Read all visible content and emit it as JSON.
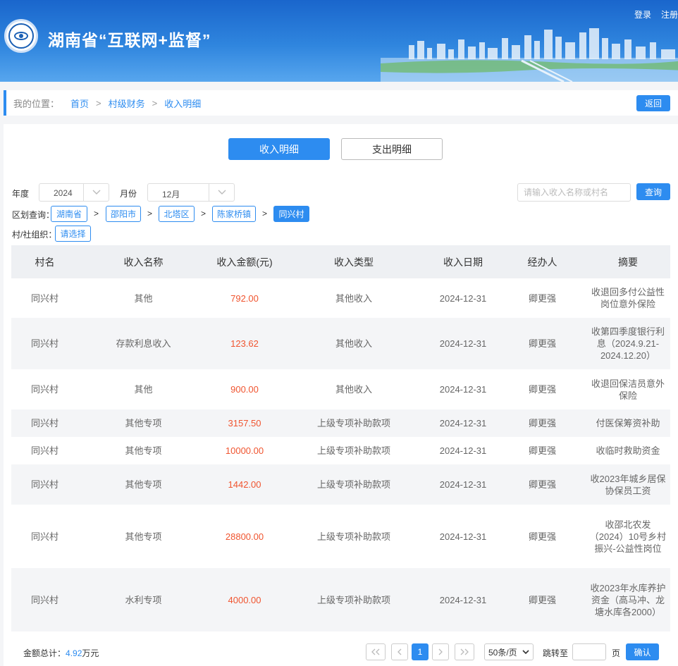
{
  "header": {
    "title": "湖南省“互联网+监督”",
    "login": "登录",
    "register": "注册"
  },
  "breadcrumb": {
    "label": "我的位置：",
    "items": [
      "首页",
      "村级财务",
      "收入明细"
    ],
    "separator": ">",
    "back": "返回"
  },
  "tabs": {
    "income": "收入明细",
    "expense": "支出明细"
  },
  "filters": {
    "year_label": "年度",
    "year_value": "2024",
    "month_label": "月份",
    "month_value": "12月",
    "search_placeholder": "请输入收入名称或村名",
    "query_button": "查询",
    "region_label": "区划查询：",
    "regions": [
      "湖南省",
      "邵阳市",
      "北塔区",
      "陈家桥镇",
      "同兴村"
    ],
    "region_separator": ">",
    "org_label": "村/社组织：",
    "org_button": "请选择"
  },
  "table": {
    "columns": [
      "村名",
      "收入名称",
      "收入金额(元)",
      "收入类型",
      "收入日期",
      "经办人",
      "摘要"
    ],
    "rows": [
      [
        "同兴村",
        "其他",
        "792.00",
        "其他收入",
        "2024-12-31",
        "卿更强",
        "收退回多付公益性岗位意外保险"
      ],
      [
        "同兴村",
        "存款利息收入",
        "123.62",
        "其他收入",
        "2024-12-31",
        "卿更强",
        "收第四季度银行利息（2024.9.21-2024.12.20）"
      ],
      [
        "同兴村",
        "其他",
        "900.00",
        "其他收入",
        "2024-12-31",
        "卿更强",
        "收退回保洁员意外保险"
      ],
      [
        "同兴村",
        "其他专项",
        "3157.50",
        "上级专项补助款项",
        "2024-12-31",
        "卿更强",
        "付医保筹资补助"
      ],
      [
        "同兴村",
        "其他专项",
        "10000.00",
        "上级专项补助款项",
        "2024-12-31",
        "卿更强",
        "收临时救助资金"
      ],
      [
        "同兴村",
        "其他专项",
        "1442.00",
        "上级专项补助款项",
        "2024-12-31",
        "卿更强",
        "收2023年城乡居保协保员工资"
      ],
      [
        "同兴村",
        "其他专项",
        "28800.00",
        "上级专项补助款项",
        "2024-12-31",
        "卿更强",
        "收邵北农发（2024）10号乡村振兴-公益性岗位"
      ],
      [
        "同兴村",
        "水利专项",
        "4000.00",
        "上级专项补助款项",
        "2024-12-31",
        "卿更强",
        "收2023年水库养护资金（高马冲、龙塘水库各2000）"
      ]
    ]
  },
  "footer": {
    "total_label": "金额总计：",
    "total_value": "4.92",
    "total_unit": "万元",
    "current_page": "1",
    "page_size": "50条/页",
    "jump_label": "跳转至",
    "page_unit": "页",
    "confirm": "确认"
  },
  "colors": {
    "primary": "#2d8cf0",
    "amount": "#f0542f",
    "header_blue": "#1a66cc"
  }
}
